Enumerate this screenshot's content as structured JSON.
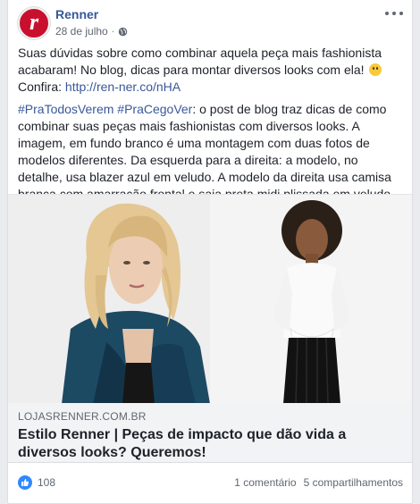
{
  "post": {
    "page_name": "Renner",
    "avatar_letter": "r",
    "date": "28 de julho",
    "dot": "·",
    "privacy_icon": "globe-icon",
    "text_p1_a": "Suas dúvidas sobre como combinar aquela peça mais fashionista acabaram! No blog, dicas para montar diversos looks com ela!",
    "text_p1_b": "Confira:",
    "text_p1_link": "http://ren-ner.co/nHA",
    "hashtags": "#PraTodosVerem #PraCegoVer",
    "text_p2": ": o post de blog traz dicas de como combinar suas peças mais fashionistas com diversos looks. A imagem, em fundo branco é uma montagem com duas fotos de modelos diferentes. Da esquerda para a direita: a modelo, no detalhe, usa blazer azul em veludo. A modelo da direita usa camisa branca com amarração frontal e saia preta midi plissada em veludo."
  },
  "link_preview": {
    "domain": "LOJASRENNER.COM.BR",
    "headline": "Estilo Renner | Peças de impacto que dão vida a diversos looks? Queremos!"
  },
  "reactions": {
    "likes": "108",
    "comments": "1 comentário",
    "shares": "5 compartilhamentos"
  },
  "colors": {
    "brand": "#c8102e",
    "link": "#385898",
    "like": "#2e89ff"
  }
}
